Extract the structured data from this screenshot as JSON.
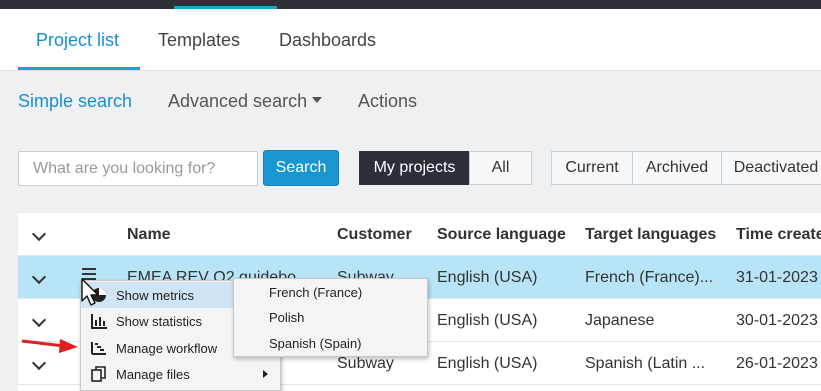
{
  "tabs": [
    {
      "label": "Project list"
    },
    {
      "label": "Templates"
    },
    {
      "label": "Dashboards"
    }
  ],
  "search_nav": {
    "simple": "Simple search",
    "advanced": "Advanced search",
    "actions": "Actions"
  },
  "search": {
    "placeholder": "What are you looking for?",
    "button": "Search"
  },
  "scope": {
    "my_projects": "My projects",
    "all": "All"
  },
  "status_filter": {
    "current": "Current",
    "archived": "Archived",
    "deactivated": "Deactivated"
  },
  "table": {
    "columns": [
      "Name",
      "Customer",
      "Source language",
      "Target languages",
      "Time create"
    ],
    "rows": [
      {
        "name": "EMEA REV Q2 guidebo...",
        "customer": "Subway",
        "source": "English (USA)",
        "target": "French (France)...",
        "time": "31-01-2023"
      },
      {
        "name": "",
        "customer": "",
        "source": "English (USA)",
        "target": "Japanese",
        "time": "30-01-2023"
      },
      {
        "name": "...e...",
        "customer": "Subway",
        "source": "English (USA)",
        "target": "Spanish (Latin ...",
        "time": "26-01-2023"
      }
    ]
  },
  "context_menu": {
    "items": [
      {
        "label": "Show metrics",
        "icon": "pie-chart-icon"
      },
      {
        "label": "Show statistics",
        "icon": "bar-chart-icon"
      },
      {
        "label": "Manage workflow",
        "icon": "workflow-icon"
      },
      {
        "label": "Manage files",
        "icon": "files-icon"
      }
    ]
  },
  "language_popup": {
    "items": [
      "French (France)",
      "Polish",
      "Spanish (Spain)"
    ]
  },
  "colors": {
    "accent": "#1ba0d8",
    "selected_row": "#b8e4f7",
    "dark_button": "#2b3038",
    "annotation_arrow": "#e02020"
  }
}
